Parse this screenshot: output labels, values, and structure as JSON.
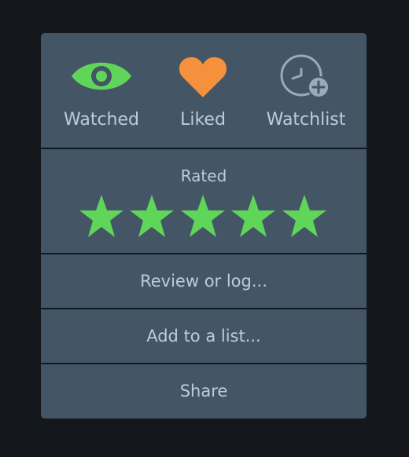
{
  "actions": {
    "watched": {
      "label": "Watched",
      "icon": "eye-icon",
      "color": "#40bcf4"
    },
    "liked": {
      "label": "Liked",
      "icon": "heart-icon",
      "color": "#f5913c"
    },
    "watchlist": {
      "label": "Watchlist",
      "icon": "clock-plus-icon",
      "color": "#9ab"
    }
  },
  "rating": {
    "label": "Rated",
    "value": 5,
    "max": 5,
    "star_color": "#5fd65a"
  },
  "menu": {
    "review": "Review or log...",
    "add_to_list": "Add to a list...",
    "share": "Share"
  },
  "colors": {
    "panel_bg": "#456",
    "page_bg": "#14181c",
    "text": "#bcd",
    "watched_green": "#5fd65a"
  }
}
